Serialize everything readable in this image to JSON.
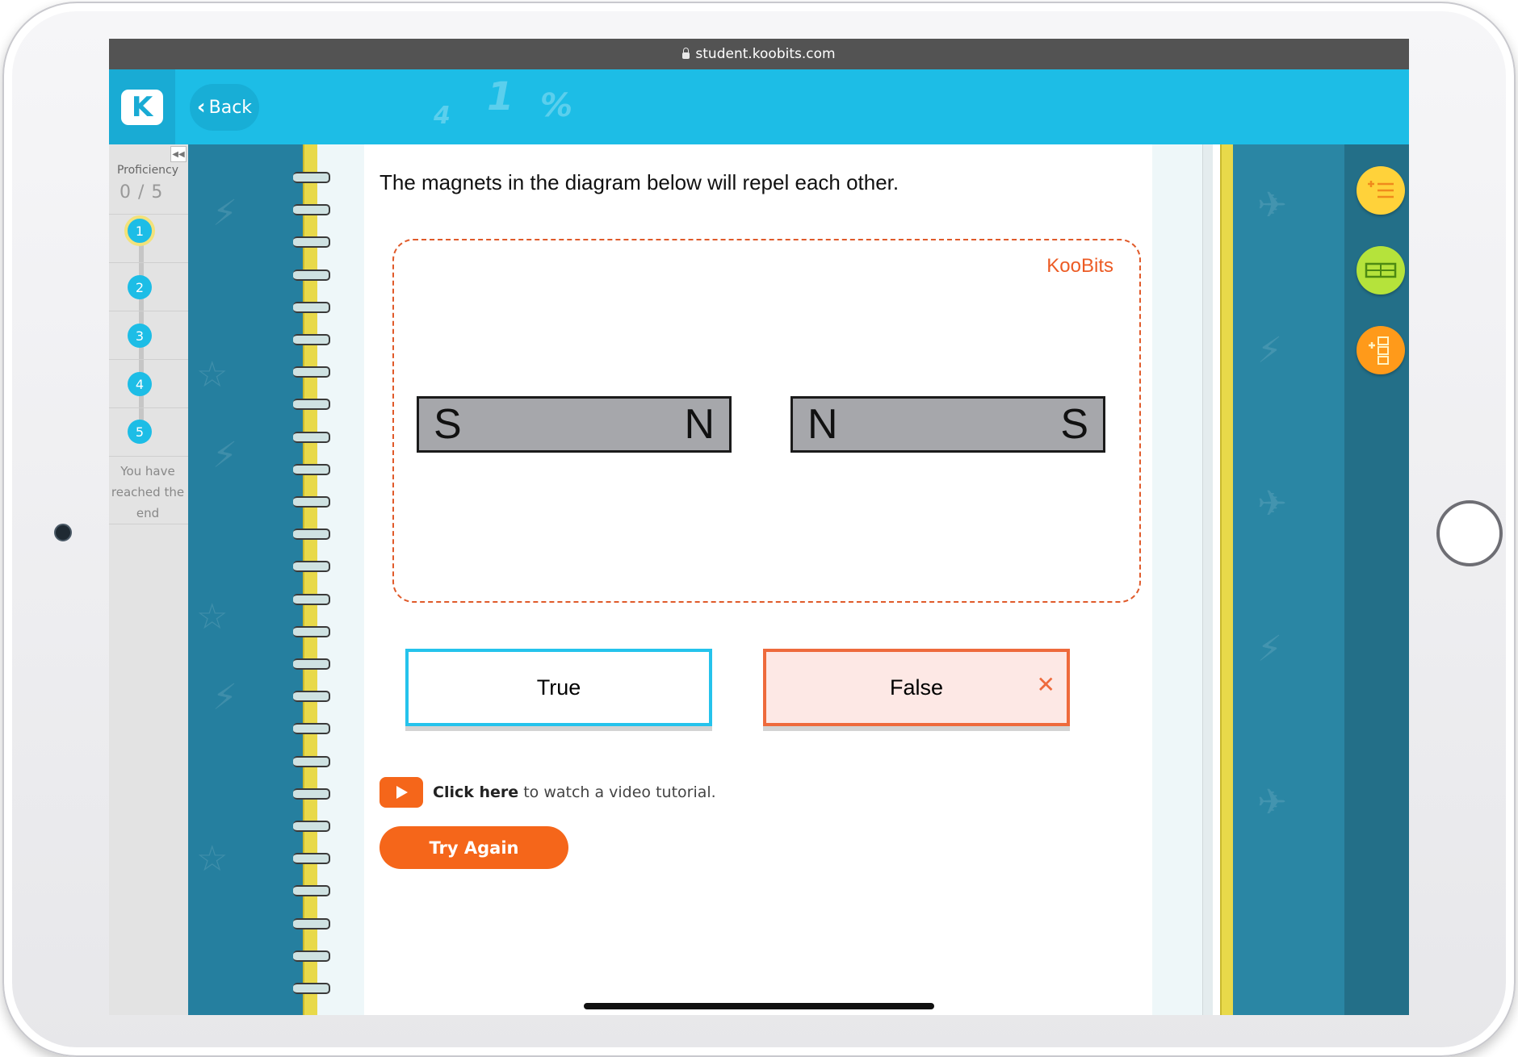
{
  "browser": {
    "url": "student.koobits.com"
  },
  "header": {
    "logo_text": "K",
    "back_label": "Back",
    "deco": [
      "4",
      "1",
      "%"
    ]
  },
  "sidebar": {
    "proficiency_label": "Proficiency",
    "proficiency_score": "0 / 5",
    "questions": [
      "1",
      "2",
      "3",
      "4",
      "5"
    ],
    "current_question": "1",
    "end_message": [
      "You have",
      "reached the",
      "end"
    ]
  },
  "question": {
    "text": "The magnets in the diagram below will repel each other.",
    "watermark": "KooBits",
    "magnets": [
      {
        "left_pole": "S",
        "right_pole": "N"
      },
      {
        "left_pole": "N",
        "right_pole": "S"
      }
    ]
  },
  "answers": {
    "true_label": "True",
    "false_label": "False",
    "false_mark": "✕",
    "selected": "False",
    "selected_state": "incorrect"
  },
  "video": {
    "link_text": "Click here",
    "rest_text": "to watch a video tutorial."
  },
  "actions": {
    "try_again_label": "Try Again"
  },
  "tools": [
    {
      "name": "number-line-tool-icon",
      "color": "#ffd23a"
    },
    {
      "name": "bar-model-tool-icon",
      "color": "#b5e33b"
    },
    {
      "name": "place-value-tool-icon",
      "color": "#ff9a1a"
    }
  ],
  "colors": {
    "brand_blue": "#1dbde6",
    "accent_orange": "#f5661a",
    "teal": "#257f9f",
    "error_red": "#ee6a3c"
  }
}
